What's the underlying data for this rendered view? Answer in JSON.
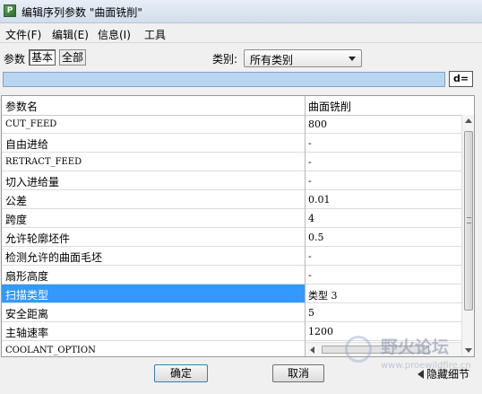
{
  "window": {
    "title": "编辑序列参数 \"曲面铣削\""
  },
  "menu": [
    "文件(F)",
    "编辑(E)",
    "信息(I)",
    "工具"
  ],
  "toolbar": {
    "params_label": "参数",
    "basic_tab": "基本",
    "all_tab": "全部",
    "category_label": "类别:",
    "category_value": "所有类别"
  },
  "filter_button": "d=",
  "table": {
    "col_name": "参数名",
    "col_value": "曲面铣削",
    "rows": [
      {
        "name": "CUT_FEED",
        "value": "800"
      },
      {
        "name": "自由进给",
        "value": "-"
      },
      {
        "name": "RETRACT_FEED",
        "value": "-"
      },
      {
        "name": "切入进给量",
        "value": "-"
      },
      {
        "name": "公差",
        "value": "0.01"
      },
      {
        "name": "跨度",
        "value": "4"
      },
      {
        "name": "允许轮廓坯件",
        "value": "0.5"
      },
      {
        "name": "检测允许的曲面毛坯",
        "value": "-"
      },
      {
        "name": "扇形高度",
        "value": "-"
      },
      {
        "name": "扫描类型",
        "value": "类型 3"
      },
      {
        "name": "安全距离",
        "value": "5"
      },
      {
        "name": "主轴速率",
        "value": "1200"
      },
      {
        "name": "COOLANT_OPTION",
        "value": ""
      }
    ],
    "selected_row": 9
  },
  "buttons": {
    "ok": "确定",
    "cancel": "取消",
    "hide_details": "隐藏细节"
  },
  "watermark": {
    "title": "野火论坛",
    "url": "www.proewildfire.cn"
  }
}
